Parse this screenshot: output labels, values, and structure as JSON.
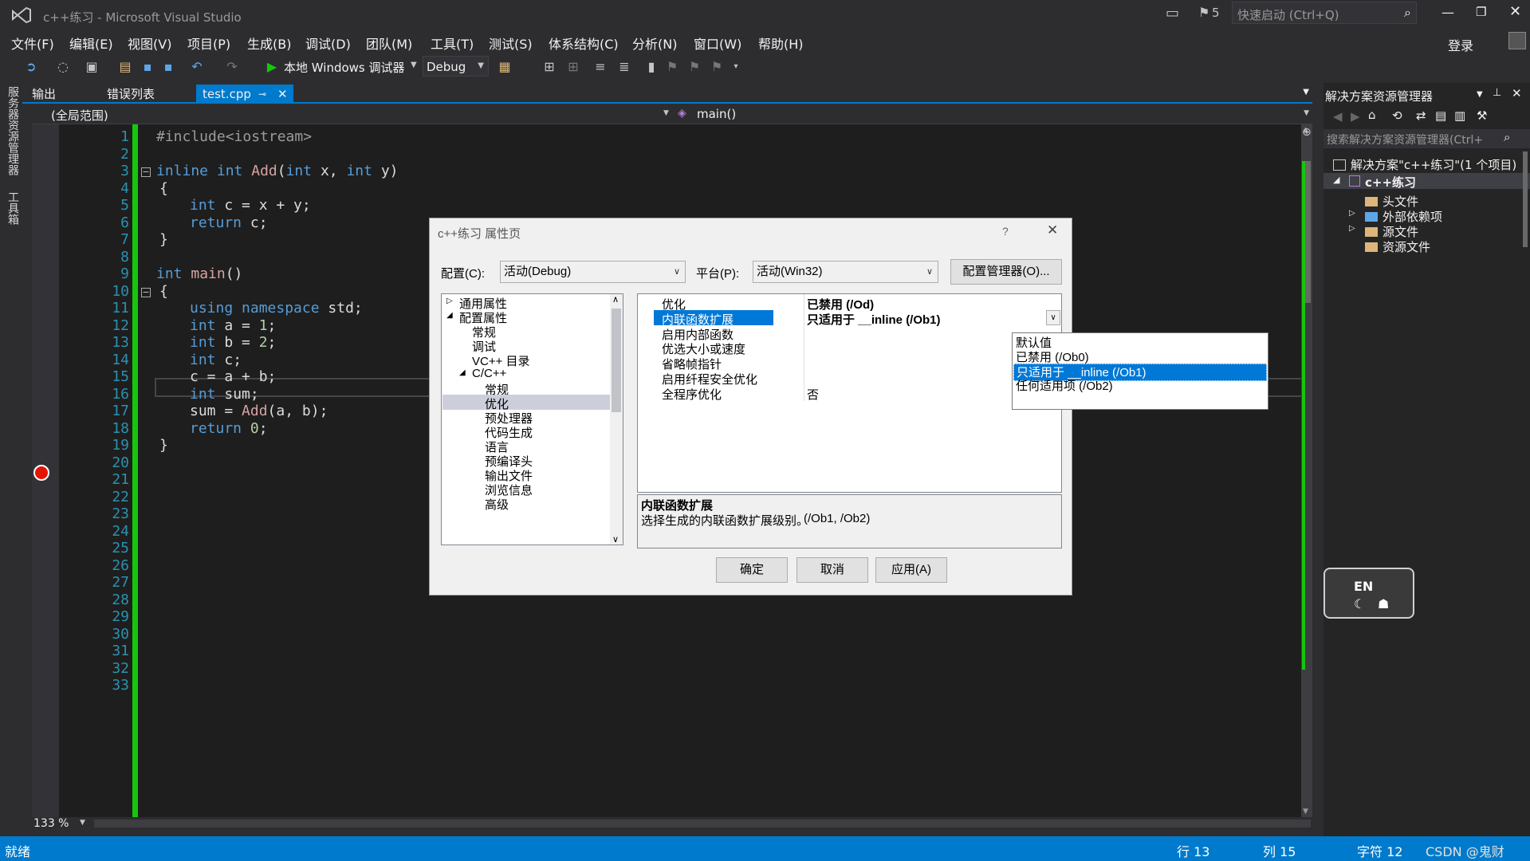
{
  "window": {
    "title": "c++练习 - Microsoft Visual Studio",
    "quick_launch_placeholder": "快速启动 (Ctrl+Q)",
    "notification_count": "5",
    "login": "登录"
  },
  "menu": [
    "文件(F)",
    "编辑(E)",
    "视图(V)",
    "项目(P)",
    "生成(B)",
    "调试(D)",
    "团队(M)",
    "工具(T)",
    "测试(S)",
    "体系结构(C)",
    "分析(N)",
    "窗口(W)",
    "帮助(H)"
  ],
  "toolbar": {
    "run_label": "本地 Windows 调试器",
    "config": "Debug"
  },
  "left_strip": {
    "server_explorer": "服务器资源管理器",
    "toolbox": "工具箱"
  },
  "tabs": {
    "output": "输出",
    "error_list": "错误列表",
    "active": "test.cpp"
  },
  "navbar": {
    "scope": "(全局范围)",
    "member": "main()"
  },
  "editor": {
    "zoom": "133 %",
    "line_numbers": [
      "1",
      "2",
      "3",
      "4",
      "5",
      "6",
      "7",
      "8",
      "9",
      "10",
      "11",
      "12",
      "13",
      "14",
      "15",
      "16",
      "17",
      "18",
      "19",
      "20",
      "21",
      "22",
      "23",
      "24",
      "25",
      "26",
      "27",
      "28",
      "29",
      "30",
      "31",
      "32",
      "33"
    ],
    "code": {
      "l1": "#include<iostream>",
      "l3a": "inline",
      "l3b": "int",
      "l3c": "Add",
      "l3d": "(",
      "l3e": "int",
      "l3f": " x, ",
      "l3g": "int",
      "l3h": " y)",
      "l4": "{",
      "l5a": "int",
      "l5b": " c = x + y;",
      "l6a": "return",
      "l6b": " c;",
      "l7": "}",
      "l9a": "int",
      "l9b": "main",
      "l9c": "()",
      "l10": "{",
      "l11a": "using",
      "l11b": "namespace",
      "l11c": " std;",
      "l12a": "int",
      "l12b": " a = ",
      "l12c": "1",
      "l12d": ";",
      "l13a": "int",
      "l13b": " b = ",
      "l13c": "2",
      "l13d": ";",
      "l14a": "int",
      "l14b": " c;",
      "l15": "c = a + b;",
      "l16a": "int",
      "l16b": " sum;",
      "l17a": "sum = ",
      "l17b": "Add",
      "l17c": "(a, b);",
      "l18a": "return",
      "l18b": " ",
      "l18c": "0",
      "l18d": ";",
      "l19": "}"
    }
  },
  "solution_explorer": {
    "title": "解决方案资源管理器",
    "search_placeholder": "搜索解决方案资源管理器(Ctrl+",
    "solution": "解决方案\"c++练习\"(1 个项目)",
    "project": "c++练习",
    "items": [
      "头文件",
      "外部依赖项",
      "源文件",
      "资源文件"
    ]
  },
  "dialog": {
    "title": "c++练习 属性页",
    "help": "?",
    "config_label": "配置(C):",
    "config_value": "活动(Debug)",
    "platform_label": "平台(P):",
    "platform_value": "活动(Win32)",
    "config_manager": "配置管理器(O)...",
    "tree": [
      "通用属性",
      "配置属性",
      "常规",
      "调试",
      "VC++ 目录",
      "C/C++",
      "常规",
      "优化",
      "预处理器",
      "代码生成",
      "语言",
      "预编译头",
      "输出文件",
      "浏览信息",
      "高级"
    ],
    "props": [
      {
        "name": "优化",
        "value": "已禁用 (/Od)"
      },
      {
        "name": "内联函数扩展",
        "value": "只适用于 __inline (/Ob1)"
      },
      {
        "name": "启用内部函数",
        "value": ""
      },
      {
        "name": "优选大小或速度",
        "value": ""
      },
      {
        "name": "省略帧指针",
        "value": ""
      },
      {
        "name": "启用纤程安全优化",
        "value": ""
      },
      {
        "name": "全程序优化",
        "value": "否"
      }
    ],
    "dropdown": [
      "默认值",
      "已禁用 (/Ob0)",
      "只适用于 __inline (/Ob1)",
      "任何适用项 (/Ob2)"
    ],
    "desc_title": "内联函数扩展",
    "desc_text": "选择生成的内联函数扩展级别。",
    "desc_flags": "(/Ob1, /Ob2)",
    "ok": "确定",
    "cancel": "取消",
    "apply": "应用(A)"
  },
  "status": {
    "ready": "就绪",
    "line": "行 13",
    "col": "列 15",
    "char": "字符 12",
    "watermark": "CSDN @鬼财"
  },
  "ime": {
    "label": "EN"
  },
  "colors": {
    "accent": "#007acc",
    "editor_bg": "#1e1e1e",
    "selection": "#0078d7",
    "breakpoint": "#e51400",
    "change_bar": "#16c60c"
  }
}
